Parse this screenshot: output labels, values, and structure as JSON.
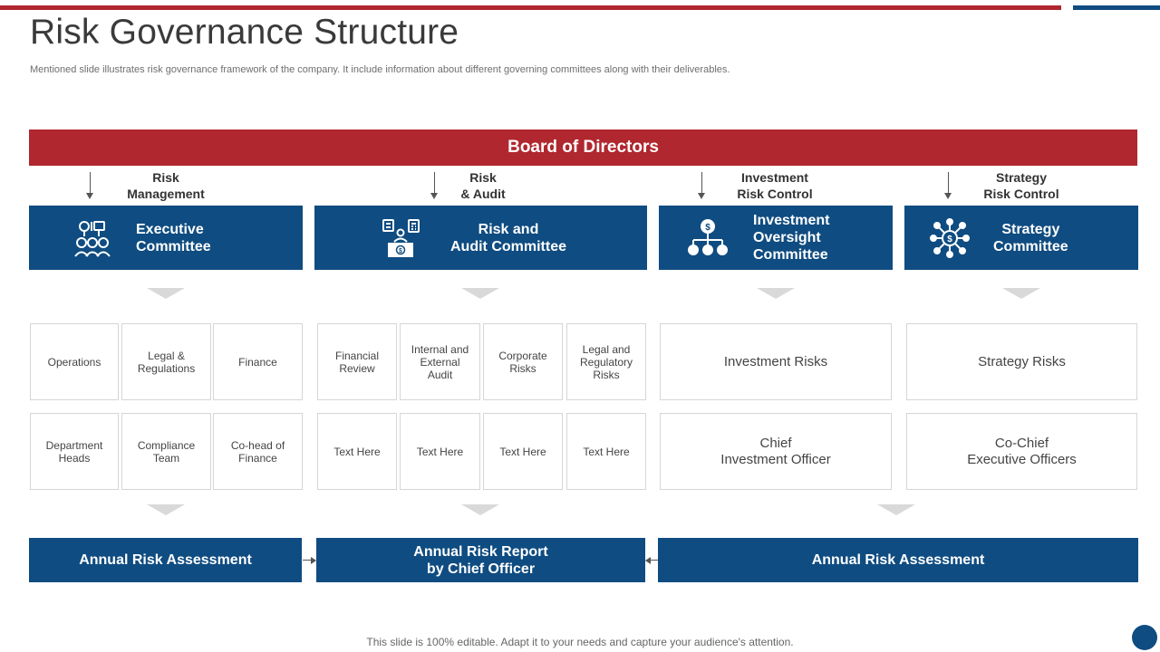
{
  "title": "Risk Governance Structure",
  "subtitle": "Mentioned slide illustrates risk governance framework of the company. It include information about different governing committees along with their deliverables.",
  "board": "Board of Directors",
  "flow_labels": [
    "Risk\nManagement",
    "Risk\n& Audit",
    "Investment\nRisk Control",
    "Strategy\nRisk Control"
  ],
  "committees": [
    {
      "label": "Executive\nCommittee",
      "icon": "team-icon"
    },
    {
      "label": "Risk and\nAudit Committee",
      "icon": "audit-desk-icon"
    },
    {
      "label": "Investment\nOversight\nCommittee",
      "icon": "org-chart-dollar-icon"
    },
    {
      "label": "Strategy\nCommittee",
      "icon": "network-hub-icon"
    }
  ],
  "grid": {
    "executive": [
      "Operations",
      "Legal &\nRegulations",
      "Finance",
      "Department\nHeads",
      "Compliance\nTeam",
      "Co-head of\nFinance"
    ],
    "audit": [
      "Financial\nReview",
      "Internal and\nExternal\nAudit",
      "Corporate\nRisks",
      "Legal and\nRegulatory\nRisks",
      "Text Here",
      "Text Here",
      "Text Here",
      "Text Here"
    ],
    "investment": [
      "Investment Risks",
      "Chief\nInvestment Officer"
    ],
    "strategy": [
      "Strategy Risks",
      "Co-Chief\nExecutive Officers"
    ]
  },
  "outputs": [
    "Annual Risk Assessment",
    "Annual Risk Report\nby Chief Officer",
    "Annual Risk Assessment"
  ],
  "footer": "This slide is 100% editable. Adapt it to your needs and capture your audience's attention.",
  "colors": {
    "red": "#b0272f",
    "blue": "#0f4c81",
    "chevron": "#d9d9d9"
  }
}
